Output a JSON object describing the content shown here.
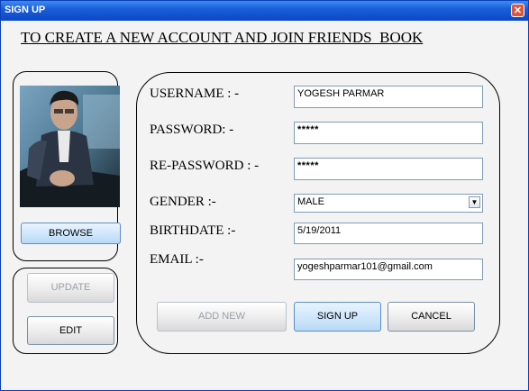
{
  "window": {
    "title": "SIGN UP",
    "close_glyph": "✕"
  },
  "heading": "TO CREATE A NEW ACCOUNT AND JOIN FRIENDS_BOOK",
  "photo_panel": {
    "browse_label": "BROWSE"
  },
  "actions": {
    "update_label": "UPDATE",
    "edit_label": "EDIT"
  },
  "form": {
    "username_label": "USERNAME : -",
    "username_value": "YOGESH PARMAR",
    "password_label": "PASSWORD: -",
    "password_value": "*****",
    "repassword_label": "RE-PASSWORD : -",
    "repassword_value": "*****",
    "gender_label": "GENDER :-",
    "gender_value": "MALE",
    "birthdate_label": "BIRTHDATE :-",
    "birthdate_value": "5/19/2011",
    "email_label": "EMAIL :-",
    "email_value": "yogeshparmar101@gmail.com"
  },
  "buttons": {
    "add_new_label": "ADD NEW",
    "sign_up_label": "SIGN UP",
    "cancel_label": "CANCEL"
  },
  "icons": {
    "dropdown": "chevron-down-icon",
    "close": "close-icon"
  },
  "colors": {
    "titlebar": "#1b5fd8",
    "focus_button": "#cfe6fb"
  }
}
